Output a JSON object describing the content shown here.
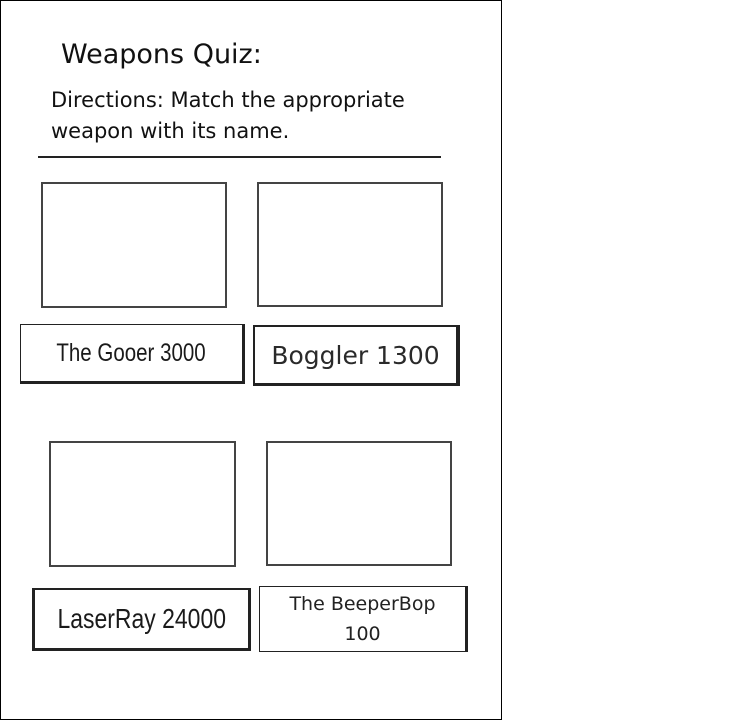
{
  "quiz": {
    "title": "Weapons Quiz:",
    "directions": "Directions: Match the appropriate\nweapon with its name."
  },
  "weapons": [
    {
      "label": "The Gooer 3000"
    },
    {
      "label": "Boggler 1300"
    },
    {
      "label": "LaserRay 24000"
    },
    {
      "label": "The BeeperBop\n100"
    }
  ]
}
